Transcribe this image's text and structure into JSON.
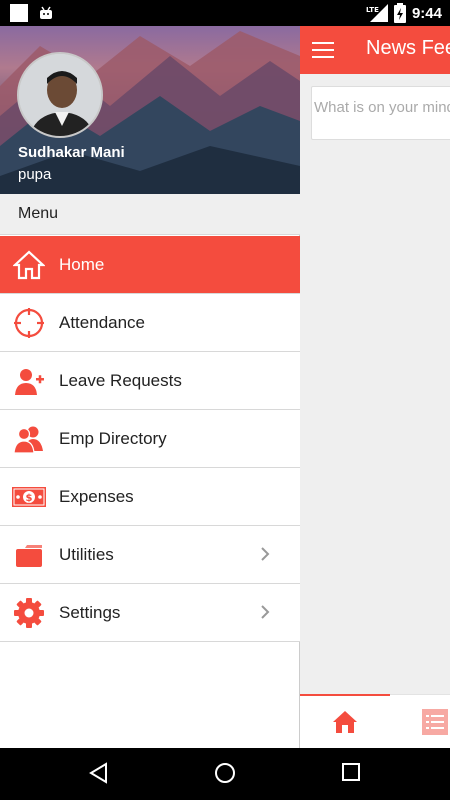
{
  "status_bar": {
    "time": "9:44",
    "network": "LTE",
    "icons": [
      "notification-square-icon",
      "android-icon",
      "signal-icon",
      "battery-icon"
    ]
  },
  "news_feed": {
    "title": "News Feed",
    "post_placeholder": "What is on your mind"
  },
  "drawer": {
    "user_name": "Sudhakar Mani",
    "user_role": "pupa",
    "menu_header": "Menu",
    "items": [
      {
        "label": "Home",
        "icon": "home-icon",
        "active": true,
        "has_chevron": false
      },
      {
        "label": "Attendance",
        "icon": "target-icon",
        "active": false,
        "has_chevron": false
      },
      {
        "label": "Leave Requests",
        "icon": "add-user-icon",
        "active": false,
        "has_chevron": false
      },
      {
        "label": "Emp Directory",
        "icon": "people-icon",
        "active": false,
        "has_chevron": false
      },
      {
        "label": "Expenses",
        "icon": "money-icon",
        "active": false,
        "has_chevron": false
      },
      {
        "label": "Utilities",
        "icon": "folder-icon",
        "active": false,
        "has_chevron": true
      },
      {
        "label": "Settings",
        "icon": "gear-icon",
        "active": false,
        "has_chevron": true
      }
    ]
  },
  "colors": {
    "accent": "#f44c3e",
    "menu_header_bg": "#efefef",
    "text": "#222222"
  },
  "nav_bar": {
    "icons": [
      "back-icon",
      "home-circle-icon",
      "recents-icon"
    ]
  }
}
